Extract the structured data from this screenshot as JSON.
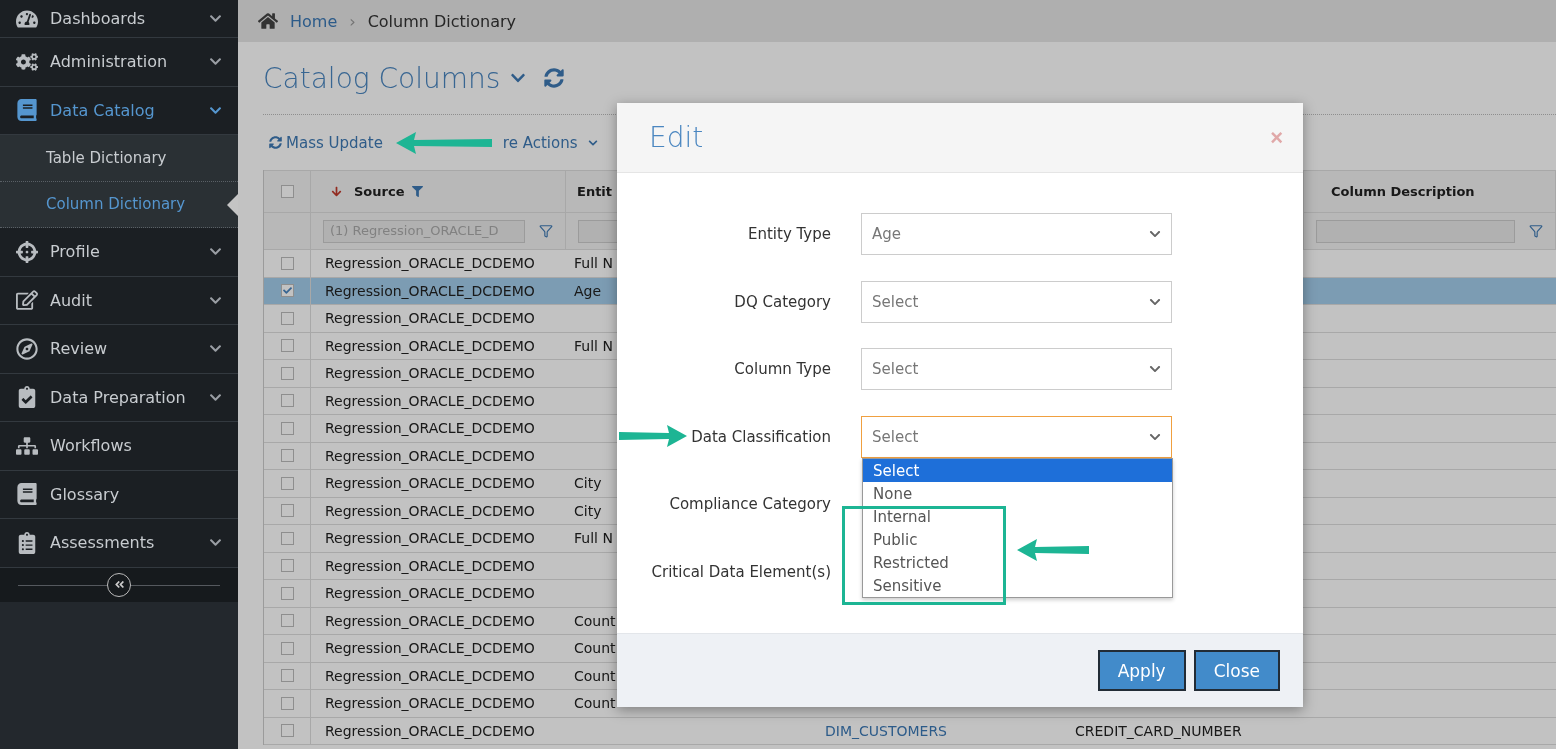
{
  "sidebar": {
    "items": [
      {
        "label": "Dashboards",
        "expandable": true,
        "expanded": false,
        "selected": false
      },
      {
        "label": "Administration",
        "expandable": true,
        "expanded": false,
        "selected": false
      },
      {
        "label": "Data Catalog",
        "expandable": true,
        "expanded": true,
        "selected": true,
        "children": [
          {
            "label": "Table Dictionary",
            "selected": false
          },
          {
            "label": "Column Dictionary",
            "selected": true
          }
        ]
      },
      {
        "label": "Profile",
        "expandable": true,
        "expanded": false,
        "selected": false
      },
      {
        "label": "Audit",
        "expandable": true,
        "expanded": false,
        "selected": false
      },
      {
        "label": "Review",
        "expandable": true,
        "expanded": false,
        "selected": false
      },
      {
        "label": "Data Preparation",
        "expandable": true,
        "expanded": false,
        "selected": false
      },
      {
        "label": "Workflows",
        "expandable": false,
        "selected": false
      },
      {
        "label": "Glossary",
        "expandable": false,
        "selected": false
      },
      {
        "label": "Assessments",
        "expandable": true,
        "expanded": false,
        "selected": false
      }
    ]
  },
  "breadcrumb": {
    "items": [
      "Home",
      "Column Dictionary"
    ],
    "separator": "›"
  },
  "page_title": "Catalog Columns",
  "toolbar": {
    "mass_update": "Mass Update",
    "more_actions": "re Actions"
  },
  "table": {
    "all_selected": false,
    "header": {
      "source": "Source",
      "entity": "Entit",
      "description": "Column Description"
    },
    "source_filter": "(1) Regression_ORACLE_D",
    "rows": [
      {
        "selected": false,
        "source": "Regression_ORACLE_DCDEMO",
        "entity": "Full N"
      },
      {
        "selected": true,
        "source": "Regression_ORACLE_DCDEMO",
        "entity": "Age"
      },
      {
        "selected": false,
        "source": "Regression_ORACLE_DCDEMO"
      },
      {
        "selected": false,
        "source": "Regression_ORACLE_DCDEMO",
        "entity": "Full N"
      },
      {
        "selected": false,
        "source": "Regression_ORACLE_DCDEMO"
      },
      {
        "selected": false,
        "source": "Regression_ORACLE_DCDEMO"
      },
      {
        "selected": false,
        "source": "Regression_ORACLE_DCDEMO"
      },
      {
        "selected": false,
        "source": "Regression_ORACLE_DCDEMO"
      },
      {
        "selected": false,
        "source": "Regression_ORACLE_DCDEMO",
        "entity": "City"
      },
      {
        "selected": false,
        "source": "Regression_ORACLE_DCDEMO",
        "entity": "City"
      },
      {
        "selected": false,
        "source": "Regression_ORACLE_DCDEMO",
        "entity": "Full N"
      },
      {
        "selected": false,
        "source": "Regression_ORACLE_DCDEMO"
      },
      {
        "selected": false,
        "source": "Regression_ORACLE_DCDEMO"
      },
      {
        "selected": false,
        "source": "Regression_ORACLE_DCDEMO",
        "entity": "Count"
      },
      {
        "selected": false,
        "source": "Regression_ORACLE_DCDEMO",
        "entity": "Count"
      },
      {
        "selected": false,
        "source": "Regression_ORACLE_DCDEMO",
        "entity": "Count"
      },
      {
        "selected": false,
        "source": "Regression_ORACLE_DCDEMO",
        "entity": "Count"
      },
      {
        "selected": false,
        "source": "Regression_ORACLE_DCDEMO",
        "table": "DIM_CUSTOMERS",
        "column": "CREDIT_CARD_NUMBER"
      }
    ]
  },
  "modal": {
    "title": "Edit",
    "close": "×",
    "fields": [
      {
        "label": "Entity Type",
        "kind": "select",
        "value": "Age",
        "focused": false
      },
      {
        "label": "DQ Category",
        "kind": "select",
        "value": "Select",
        "focused": false
      },
      {
        "label": "Column Type",
        "kind": "select",
        "value": "Select",
        "focused": false
      },
      {
        "label": "Data Classification",
        "kind": "select",
        "value": "Select",
        "focused": true
      },
      {
        "label": "Compliance Category",
        "kind": "covered"
      },
      {
        "label": "Critical Data Element(s)",
        "kind": "covered"
      }
    ],
    "dropdown": {
      "options": [
        {
          "label": "Select",
          "selected": true
        },
        {
          "label": "None",
          "selected": false
        },
        {
          "label": "Internal",
          "selected": false
        },
        {
          "label": "Public",
          "selected": false
        },
        {
          "label": "Restricted",
          "selected": false
        },
        {
          "label": "Sensitive",
          "selected": false
        }
      ]
    },
    "buttons": [
      "Apply",
      "Close"
    ]
  }
}
